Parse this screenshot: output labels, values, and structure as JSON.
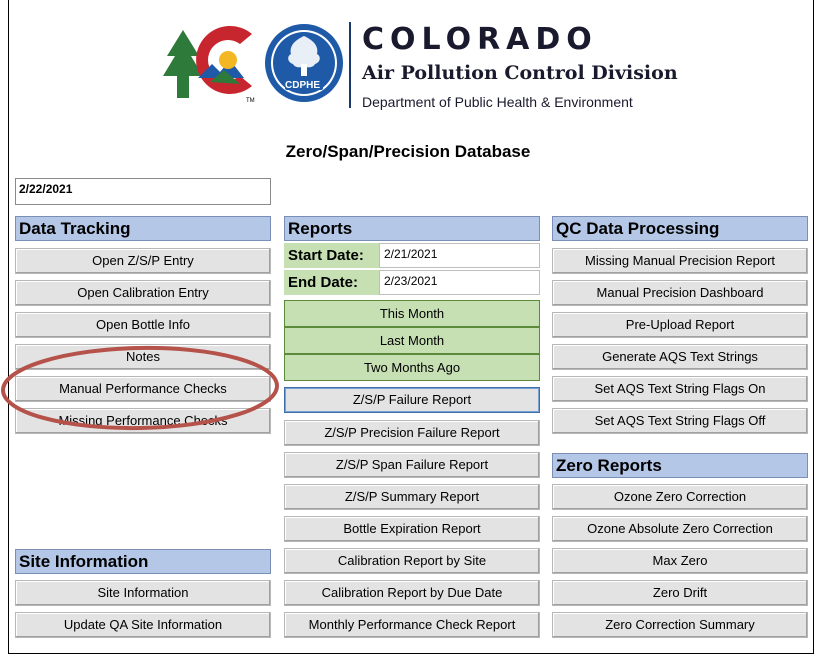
{
  "header": {
    "title": "COLORADO",
    "division": "Air Pollution Control Division",
    "department": "Department of Public Health & Environment",
    "cdphe_label": "CDPHE",
    "tm": "TM"
  },
  "database_title": "Zero/Span/Precision Database",
  "current_date": "2/22/2021",
  "data_tracking": {
    "heading": "Data Tracking",
    "buttons": [
      "Open Z/S/P Entry",
      "Open Calibration Entry",
      "Open Bottle Info",
      "Notes",
      "Manual Performance Checks",
      "Missing Performance Checks"
    ]
  },
  "site_information": {
    "heading": "Site Information",
    "buttons": [
      "Site Information",
      "Update QA Site Information"
    ]
  },
  "reports": {
    "heading": "Reports",
    "start_label": "Start Date:",
    "start_value": "2/21/2021",
    "end_label": "End Date:",
    "end_value": "2/23/2021",
    "quick_ranges": [
      "This Month",
      "Last Month",
      "Two Months Ago"
    ],
    "buttons": [
      "Z/S/P Failure Report",
      "Z/S/P Precision Failure Report",
      "Z/S/P Span Failure Report",
      "Z/S/P Summary Report",
      "Bottle Expiration Report",
      "Calibration Report by Site",
      "Calibration Report by Due Date",
      "Monthly Performance Check Report"
    ]
  },
  "qc_data_processing": {
    "heading": "QC Data Processing",
    "buttons": [
      "Missing Manual Precision Report",
      "Manual Precision Dashboard",
      "Pre-Upload Report",
      "Generate AQS Text Strings",
      "Set AQS Text String Flags On",
      "Set AQS Text String Flags Off"
    ]
  },
  "zero_reports": {
    "heading": "Zero Reports",
    "buttons": [
      "Ozone Zero Correction",
      "Ozone Absolute Zero Correction",
      "Max Zero",
      "Zero Drift",
      "Zero Correction Summary"
    ]
  },
  "colors": {
    "section_header": "#b4c7e7",
    "green": "#c6e0b4",
    "annotation": "#b5524a",
    "button": "#e3e3e3"
  }
}
